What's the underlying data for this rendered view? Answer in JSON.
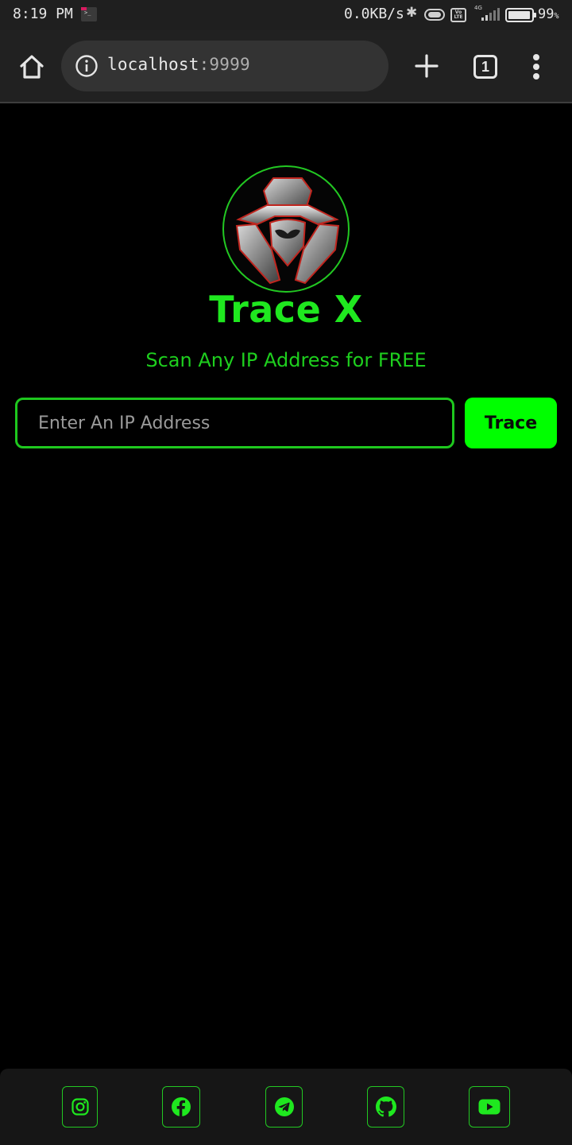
{
  "status_bar": {
    "time": "8:19 PM",
    "net_speed": "0.0KB/s",
    "volte_label": "Vo LTE",
    "network_type": "4G",
    "battery_percent": "99",
    "battery_unit": "%",
    "battery_level": 0.99
  },
  "browser": {
    "url_host": "localhost",
    "url_port": ":9999",
    "tab_count": "1",
    "icons": [
      "home-icon",
      "info-icon",
      "plus-icon",
      "tabs-icon",
      "more-vert-icon"
    ]
  },
  "page": {
    "title": "Trace X",
    "subtitle": "Scan Any IP Address for FREE",
    "input_placeholder": "Enter An IP Address",
    "input_value": "",
    "trace_button": "Trace",
    "accent_color": "#00ff00",
    "background_color": "#000000"
  },
  "footer": {
    "social_icons": [
      "instagram-icon",
      "facebook-icon",
      "telegram-icon",
      "github-icon",
      "youtube-icon"
    ]
  }
}
